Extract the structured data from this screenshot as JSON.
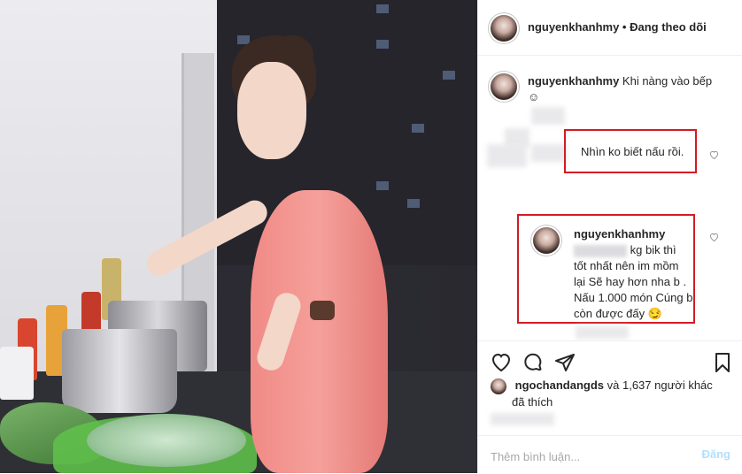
{
  "header": {
    "username": "nguyenkhanhmy",
    "separator": "•",
    "follow_status": "Đang theo dõi"
  },
  "caption": {
    "username": "nguyenkhanhmy",
    "text": "Khi nàng vào bếp",
    "emoji": "☺"
  },
  "comment1": {
    "text": "Nhìn ko biết nấu rồi."
  },
  "reply": {
    "username": "nguyenkhanhmy",
    "text_line1": "kg bik thì",
    "text_line2": "tốt nhất nên im mồm",
    "text_line3": "lại Sẽ hay hơn nha b .",
    "text_line4": "Nấu 1.000 món Cúng b",
    "text_line5": "còn được đấy",
    "emoji": "😏"
  },
  "likes": {
    "user": "ngochandangds",
    "rest": "và 1,637 người khác",
    "line2": "đã thích"
  },
  "add_comment": {
    "placeholder": "Thêm bình luận...",
    "post_label": "Đăng"
  },
  "icons": {
    "like": "heart-icon",
    "comment": "comment-icon",
    "share": "share-icon",
    "save": "bookmark-icon"
  },
  "colors": {
    "highlight_box": "#d21b23",
    "post_button": "#b2dffc",
    "text": "#262626",
    "muted": "#8e8e8e"
  }
}
